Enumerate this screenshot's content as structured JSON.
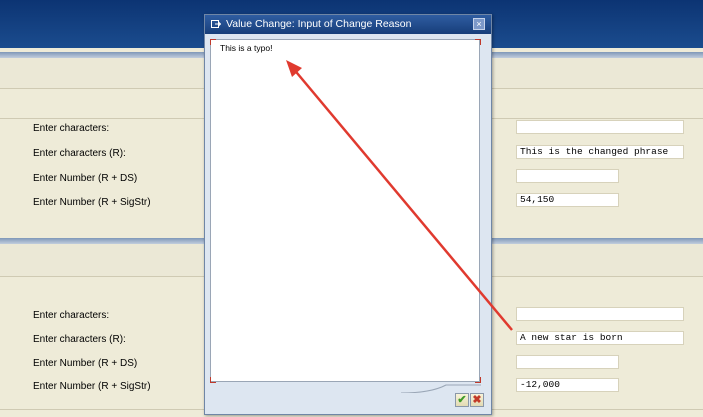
{
  "dialog": {
    "title": "Value Change: Input of Change Reason",
    "text": "This is a typo!",
    "close_label": "×",
    "ok_label": "✔",
    "cancel_label": "✖"
  },
  "section1": {
    "rows": [
      {
        "label": "Enter characters:",
        "value": ""
      },
      {
        "label": "Enter characters (R):",
        "value": "This is the changed phrase"
      },
      {
        "label": "Enter Number (R + DS)",
        "value": ""
      },
      {
        "label": "Enter Number (R + SigStr)",
        "value": "54,150"
      }
    ]
  },
  "section2": {
    "rows": [
      {
        "label": "Enter characters:",
        "value": ""
      },
      {
        "label": "Enter characters (R):",
        "value": "A new star is born"
      },
      {
        "label": "Enter Number (R + DS)",
        "value": ""
      },
      {
        "label": "Enter Number (R + SigStr)",
        "value": "-12,000"
      }
    ]
  },
  "colors": {
    "header_blue": "#0c3473",
    "background": "#eeebd8",
    "arrow_red": "#e03a2f",
    "ok_green": "#3f9a28",
    "cancel_red": "#c23a28"
  },
  "icons": [
    "dialog-title-icon",
    "close-icon",
    "check-icon",
    "cancel-icon"
  ]
}
